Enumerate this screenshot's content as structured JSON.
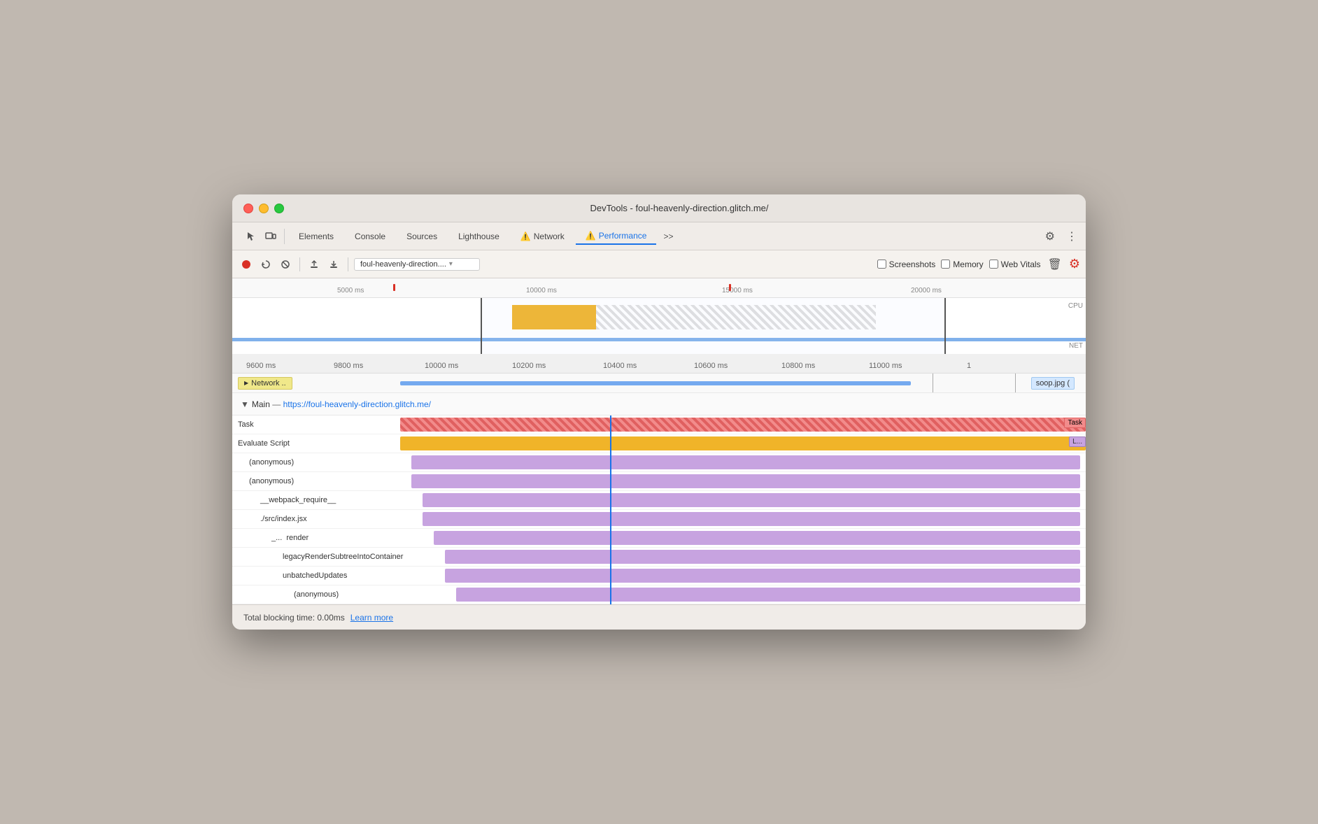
{
  "window": {
    "title": "DevTools - foul-heavenly-direction.glitch.me/"
  },
  "tabs": {
    "elements": "Elements",
    "console": "Console",
    "sources": "Sources",
    "lighthouse": "Lighthouse",
    "network": "Network",
    "performance": "Performance",
    "more": ">>"
  },
  "toolbar": {
    "url": "foul-heavenly-direction....",
    "screenshots_label": "Screenshots",
    "memory_label": "Memory",
    "web_vitals_label": "Web Vitals"
  },
  "timeline": {
    "overview_marks": [
      "5000 ms",
      "10000 ms",
      "15000 ms",
      "20000 ms"
    ],
    "cpu_label": "CPU",
    "net_label": "NET",
    "detail_marks": [
      "9600 ms",
      "9800 ms",
      "10000 ms",
      "10200 ms",
      "10400 ms",
      "10600 ms",
      "10800 ms",
      "11000 ms",
      "1"
    ]
  },
  "network_row": {
    "label": "Network ..",
    "soop_label": "soop.jpg ("
  },
  "main_section": {
    "title": "Main",
    "separator": "—",
    "url": "https://foul-heavenly-direction.glitch.me/"
  },
  "flame_rows": [
    {
      "label": "Task",
      "indent": 0,
      "bar_class": "bar-task",
      "extra_label": "Task"
    },
    {
      "label": "Evaluate Script",
      "indent": 0,
      "bar_class": "bar-evaluate",
      "extra_label": "L..."
    },
    {
      "label": "(anonymous)",
      "indent": 1,
      "bar_class": "bar-anon"
    },
    {
      "label": "(anonymous)",
      "indent": 1,
      "bar_class": "bar-anon2"
    },
    {
      "label": "__webpack_require__",
      "indent": 2,
      "bar_class": "bar-webpack"
    },
    {
      "label": "./src/index.jsx",
      "indent": 2,
      "bar_class": "bar-src"
    },
    {
      "label": "_...  render",
      "indent": 3,
      "bar_class": "bar-render"
    },
    {
      "label": "legacyRenderSubtreeIntoContainer",
      "indent": 4,
      "bar_class": "bar-legacy"
    },
    {
      "label": "unbatchedUpdates",
      "indent": 4,
      "bar_class": "bar-unbatched"
    },
    {
      "label": "(anonymous)",
      "indent": 5,
      "bar_class": "bar-anon3"
    }
  ],
  "bottom_bar": {
    "total_blocking_time": "Total blocking time: 0.00ms",
    "learn_more": "Learn more"
  },
  "colors": {
    "accent": "#1a73e8",
    "warning": "#f9a825",
    "active_tab": "#1a73e8",
    "task": "#e06060",
    "evaluate": "#f0b429",
    "flame_purple": "#c7a3e0",
    "network_yellow": "#f0e88a"
  }
}
